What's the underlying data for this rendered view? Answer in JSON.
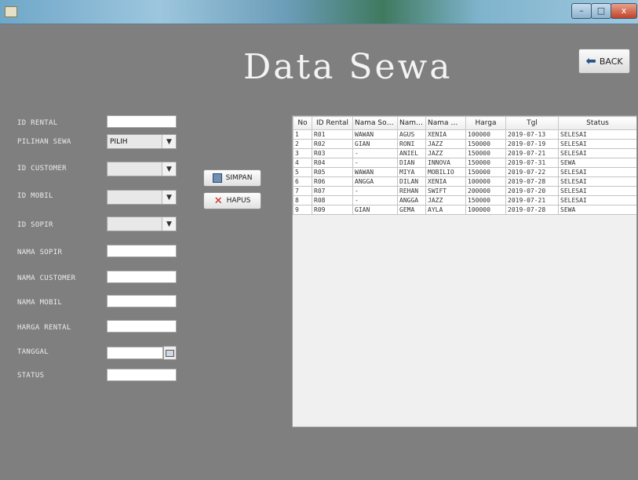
{
  "window": {
    "min_label": "–",
    "max_label": "□",
    "close_label": "x"
  },
  "page": {
    "title": "Data Sewa",
    "back_label": "BACK"
  },
  "form": {
    "labels": {
      "id_rental": "ID RENTAL",
      "pilihan_sewa": "PILIHAN SEWA",
      "id_customer": "ID CUSTOMER",
      "id_mobil": "ID MOBIL",
      "id_sopir": "ID SOPIR",
      "nama_sopir": "NAMA SOPIR",
      "nama_customer": "NAMA CUSTOMER",
      "nama_mobil": "NAMA MOBIL",
      "harga_rental": "HARGA RENTAL",
      "tanggal": "TANGGAL",
      "status": "STATUS"
    },
    "pilihan_sewa_value": "PILIH",
    "dropdown_arrow": "▼"
  },
  "buttons": {
    "simpan": "SIMPAN",
    "hapus": "HAPUS",
    "hapus_icon": "✕"
  },
  "table": {
    "columns": [
      "No",
      "ID Rental",
      "Nama Sopir",
      "Nama ...",
      "Nama Mobil",
      "Harga",
      "Tgl",
      "Status"
    ],
    "rows": [
      [
        "1",
        "R01",
        "WAWAN",
        "AGUS",
        "XENIA",
        "100000",
        "2019-07-13",
        "SELESAI"
      ],
      [
        "2",
        "R02",
        "GIAN",
        "RONI",
        "JAZZ",
        "150000",
        "2019-07-19",
        "SELESAI"
      ],
      [
        "3",
        "R03",
        "-",
        "ANIEL",
        "JAZZ",
        "150000",
        "2019-07-21",
        "SELESAI"
      ],
      [
        "4",
        "R04",
        "-",
        "DIAN",
        "INNOVA",
        "150000",
        "2019-07-31",
        "SEWA"
      ],
      [
        "5",
        "R05",
        "WAWAN",
        "MIYA",
        "MOBILIO",
        "150000",
        "2019-07-22",
        "SELESAI"
      ],
      [
        "6",
        "R06",
        "ANGGA",
        "DILAN",
        "XENIA",
        "100000",
        "2019-07-28",
        "SELESAI"
      ],
      [
        "7",
        "R07",
        "-",
        "REHAN",
        "SWIFT",
        "200000",
        "2019-07-20",
        "SELESAI"
      ],
      [
        "8",
        "R08",
        "-",
        "ANGGA",
        "JAZZ",
        "150000",
        "2019-07-21",
        "SELESAI"
      ],
      [
        "9",
        "R09",
        "GIAN",
        "GEMA",
        "AYLA",
        "100000",
        "2019-07-28",
        "SEWA"
      ]
    ]
  }
}
